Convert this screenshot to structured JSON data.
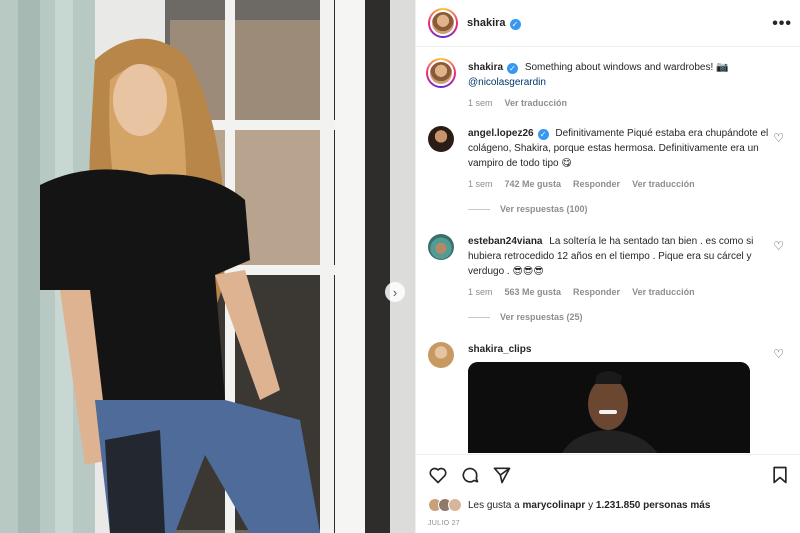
{
  "post": {
    "username": "shakira",
    "more_label": "•••"
  },
  "caption": {
    "username": "shakira",
    "text": "Something about windows and wardrobes! 📷",
    "mention": "@nicolasgerardin",
    "time": "1 sem",
    "translate": "Ver traducción"
  },
  "comments": [
    {
      "username": "angel.lopez26",
      "text": "Definitivamente Piqué estaba era chupándote el colágeno, Shakira, porque estas hermosa. Definitivamente era un vampiro de todo tipo 😋",
      "time": "1 sem",
      "likes": "742 Me gusta",
      "reply": "Responder",
      "translate": "Ver traducción",
      "view_replies": "Ver respuestas (100)"
    },
    {
      "username": "esteban24viana",
      "text": "La soltería le ha sentado tan bien . es como si hubiera retrocedido 12 años en el tiempo . Pique era su cárcel y verdugo . 😎😎😎",
      "time": "1 sem",
      "likes": "563 Me gusta",
      "reply": "Responder",
      "translate": "Ver traducción",
      "view_replies": "Ver respuestas (25)"
    },
    {
      "username": "shakira_clips"
    }
  ],
  "footer": {
    "likes_prefix": "Les gusta a",
    "likes_user": "marycolinapr",
    "likes_mid": "y",
    "likes_count": "1.231.850 personas más",
    "date": "JULIO 27"
  },
  "icons": {
    "like": "heart-icon",
    "comment": "comment-icon",
    "share": "share-icon",
    "save": "bookmark-icon",
    "next": "chevron-right-icon"
  },
  "colors": {
    "verified": "#3897f0",
    "mention": "#00376b",
    "meta": "#8e8e8e"
  }
}
